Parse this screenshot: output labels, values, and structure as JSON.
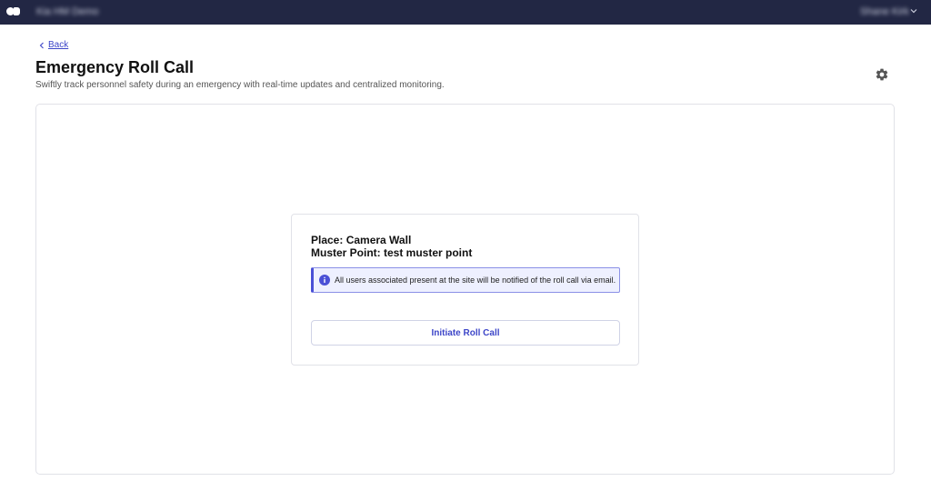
{
  "header": {
    "org_name": "Kia HM Demo",
    "user_name": "Shane Kirk"
  },
  "nav": {
    "back_label": "Back"
  },
  "page": {
    "title": "Emergency Roll Call",
    "subtitle": "Swiftly track personnel safety during an emergency with real-time updates and centralized monitoring."
  },
  "roll_call": {
    "place": "Place: Camera Wall",
    "muster_point": "Muster Point: test muster point",
    "info_message": "All users associated present at the site will be notified of the roll call via email.",
    "initiate_label": "Initiate Roll Call"
  },
  "icons": {
    "logo": "logo-icon",
    "user_menu": "chevron-down-icon",
    "back": "chevron-left-icon",
    "settings": "gear-icon",
    "info": "info-icon"
  },
  "colors": {
    "topbar": "#222744",
    "accent": "#3d46c8",
    "info_background": "#eef0ff",
    "info_border": "#4a50d6"
  }
}
